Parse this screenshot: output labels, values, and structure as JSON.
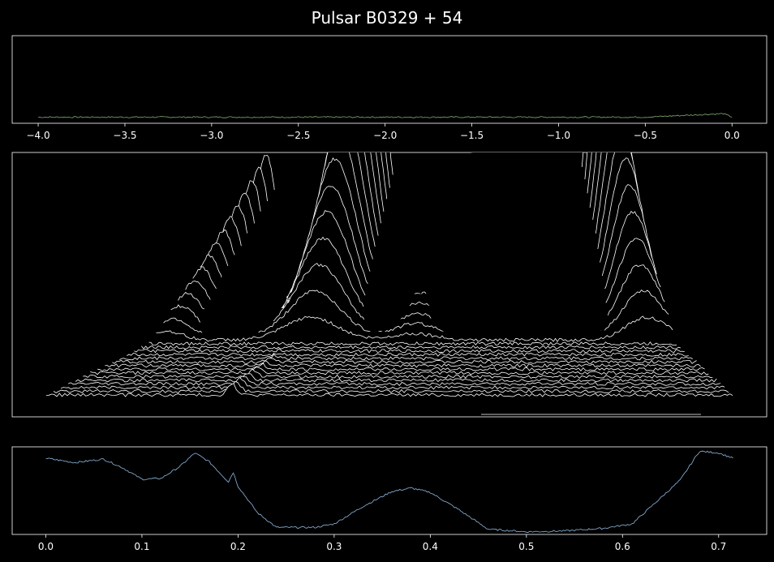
{
  "title": "Pulsar B0329 + 54",
  "chart_data": [
    {
      "type": "line",
      "panel": "top",
      "xlim": [
        -4.15,
        0.2
      ],
      "xticks": [
        "-4.0",
        "-3.5",
        "-3.0",
        "-2.5",
        "-2.0",
        "-1.5",
        "-1.0",
        "-0.5",
        "0.0"
      ],
      "xtick_values": [
        -4.0,
        -3.5,
        -3.0,
        -2.5,
        -2.0,
        -1.5,
        -1.0,
        -0.5,
        0.0
      ],
      "ylim": [
        0,
        1
      ],
      "line_color": "#7fae72",
      "x": [
        -4.0,
        -3.5,
        -3.0,
        -2.5,
        -2.0,
        -1.5,
        -1.0,
        -0.5,
        -0.05,
        0.0
      ],
      "y": [
        0.07,
        0.07,
        0.07,
        0.07,
        0.07,
        0.07,
        0.07,
        0.07,
        0.11,
        0.07
      ]
    },
    {
      "type": "line",
      "panel": "middle",
      "description_series": "stacked pulse profiles (joy plot)",
      "line_color": "#ffffff",
      "phase_range": [
        0.0,
        0.72
      ],
      "rows": 30
    },
    {
      "type": "line",
      "panel": "bottom",
      "xlim": [
        -0.035,
        0.75
      ],
      "xticks": [
        "0.0",
        "0.1",
        "0.2",
        "0.3",
        "0.4",
        "0.5",
        "0.6",
        "0.7"
      ],
      "xtick_values": [
        0.0,
        0.1,
        0.2,
        0.3,
        0.4,
        0.5,
        0.6,
        0.7
      ],
      "ylim": [
        0,
        1
      ],
      "line_color": "#8fb8e0",
      "x": [
        0.0,
        0.03,
        0.06,
        0.08,
        0.1,
        0.12,
        0.14,
        0.155,
        0.17,
        0.19,
        0.195,
        0.2,
        0.22,
        0.24,
        0.28,
        0.3,
        0.33,
        0.36,
        0.38,
        0.4,
        0.43,
        0.46,
        0.5,
        0.54,
        0.58,
        0.61,
        0.63,
        0.66,
        0.68,
        0.7,
        0.715
      ],
      "y": [
        0.87,
        0.82,
        0.86,
        0.76,
        0.63,
        0.64,
        0.78,
        0.93,
        0.83,
        0.6,
        0.71,
        0.55,
        0.25,
        0.08,
        0.08,
        0.12,
        0.32,
        0.49,
        0.53,
        0.48,
        0.28,
        0.06,
        0.03,
        0.04,
        0.07,
        0.12,
        0.32,
        0.62,
        0.95,
        0.93,
        0.87
      ]
    }
  ]
}
